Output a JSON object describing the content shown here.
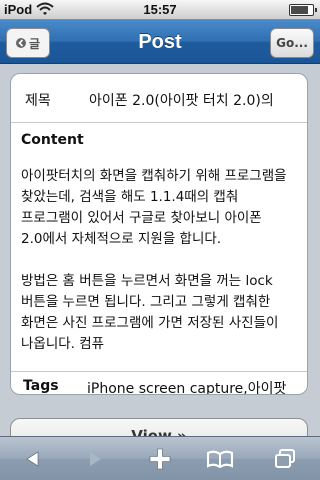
{
  "status": {
    "carrier": "iPod",
    "time": "15:57",
    "battery_level": 0.8
  },
  "nav": {
    "back_label": "글",
    "title": "Post",
    "go_label": "Go..."
  },
  "post": {
    "subject_label": "제목",
    "subject_value": "아이폰 2.0(아이팟 터치 2.0)의",
    "content_label": "Content",
    "content_paragraphs": [
      "아이팟터치의 화면을 캡춰하기 위해 프로그램을 찾았는데, 검색을 해도 1.1.4때의 캡춰 프로그램이 있어서 구글로 찾아보니 아이폰 2.0에서 자체적으로 지원을 합니다.",
      "방법은 홈 버튼을 누르면서 화면을 꺼는 lock 버튼을 누르면 됩니다. 그리고 그렇게 캡춰한 화면은 사진 프로그램에 가면 저장된 사진들이 나옵니다. 컴퓨"
    ],
    "tags_label": "Tags",
    "tags_value": "iPhone screen capture,아이팟"
  },
  "view_button_label": "View »",
  "toolbar": {
    "back": "back-arrow-icon",
    "forward": "forward-arrow-icon",
    "add": "plus-icon",
    "bookmarks": "book-icon",
    "pages": "pages-icon"
  }
}
